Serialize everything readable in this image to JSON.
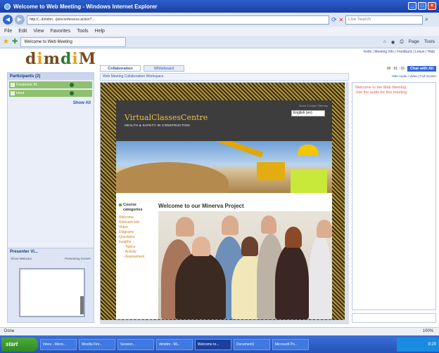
{
  "window": {
    "title": "Welcome to Web Meeting - Windows Internet Explorer"
  },
  "address": {
    "url": "http://...dimdim.../joinconference.action?...",
    "search_placeholder": "Live Search"
  },
  "menubar": [
    "File",
    "Edit",
    "View",
    "Favorites",
    "Tools",
    "Help"
  ],
  "browser_tab": {
    "label": "Welcome to Web Meeting"
  },
  "toolbar_tray": [
    "Page",
    "Tools"
  ],
  "logo": {
    "p1": "d",
    "p2": "i",
    "p3": "m",
    "p4": "d",
    "p5": "i",
    "p6": "M"
  },
  "header_links": "Invite | Meeting Info | Feedback | Leave | Help",
  "sidebar": {
    "participants_label": "Participants (2)",
    "participants": [
      "Frederick M...",
      "Host"
    ],
    "show_all": "Show All",
    "presenter_label": "Presenter Vi...",
    "presenter_tabs": [
      "Show Webcam",
      "Presenting Screen"
    ]
  },
  "main": {
    "tabs": [
      "Collaboration",
      "Whiteboard"
    ],
    "stage_toolbar": "Web Meeting Collaboration Workspace",
    "site": {
      "title": "VirtualClassesCentre",
      "subtitle": "HEALTH & SAFETY IN CONSTRUCTION",
      "top_small": "Home  Contact  Sitemap",
      "language": "English (en)",
      "menu_head": "Course categories",
      "menu_items": [
        "Welcome",
        "Relevant Info",
        "Video",
        "Diagrams",
        "Questions",
        "Insights",
        "- Topics",
        "- Activity",
        "- Assessment"
      ],
      "welcome": "Welcome to our Minerva Project"
    }
  },
  "chat": {
    "timer": "00 : 01 : 16",
    "chat_all_button": "Chat with All",
    "links": "Hide Audio / Video | Full Screen",
    "messages": [
      "Welcome to the Web Meeting.",
      "Join the audio for this meeting."
    ]
  },
  "status": {
    "left": "Done",
    "zoom": "100%"
  },
  "taskbar": {
    "start": "start",
    "items": [
      "Inbox - Micro...",
      "Mozilla Fire...",
      "Session...",
      "dimdim - Mi...",
      "Welcome to...",
      "Document1",
      "Microsoft Po..."
    ],
    "clock": "9:29"
  }
}
